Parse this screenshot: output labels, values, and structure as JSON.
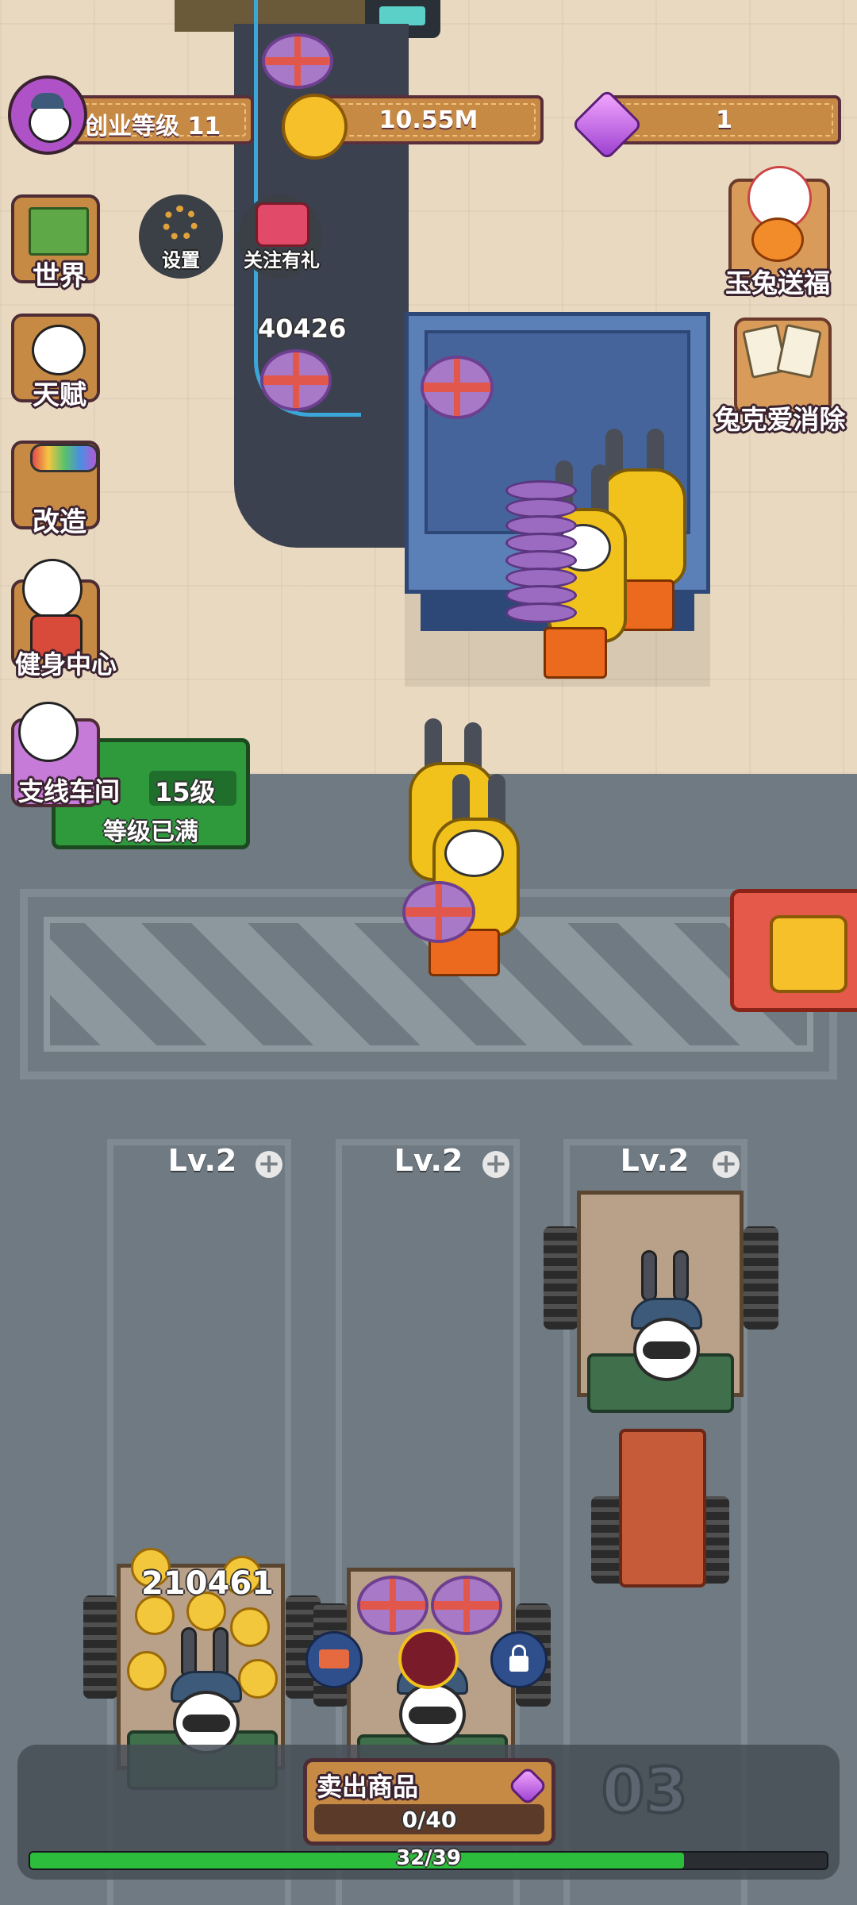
{
  "hud": {
    "level_label": "创业等级 11",
    "coins": "10.55M",
    "gems": "1"
  },
  "left_menu": {
    "world": "世界",
    "talent": "天赋",
    "upgrade": "改造",
    "gym": "健身中心",
    "branch": "支线车间"
  },
  "top_buttons": {
    "settings": "设置",
    "follow_gift": "关注有礼"
  },
  "right_menu": {
    "jade_rabbit": "玉兔送福",
    "rabbit_match": "兔克爱消除"
  },
  "scene": {
    "conveyor_count": "40426",
    "sign_level": "15级",
    "sign_status": "等级已满",
    "truck_count": "210461",
    "watermark_num": "03"
  },
  "lanes": [
    {
      "label": "Lv.2"
    },
    {
      "label": "Lv.2"
    },
    {
      "label": "Lv.2"
    }
  ],
  "bottom": {
    "sell_label": "卖出商品",
    "sell_progress": "0/40",
    "sell_fraction": 0.0,
    "xp_progress": "32/39",
    "xp_fraction": 0.8205
  },
  "colors": {
    "accent_wood": "#c78a45",
    "progress_green": "#2dbd3c",
    "cake_purple": "#a779c7"
  }
}
